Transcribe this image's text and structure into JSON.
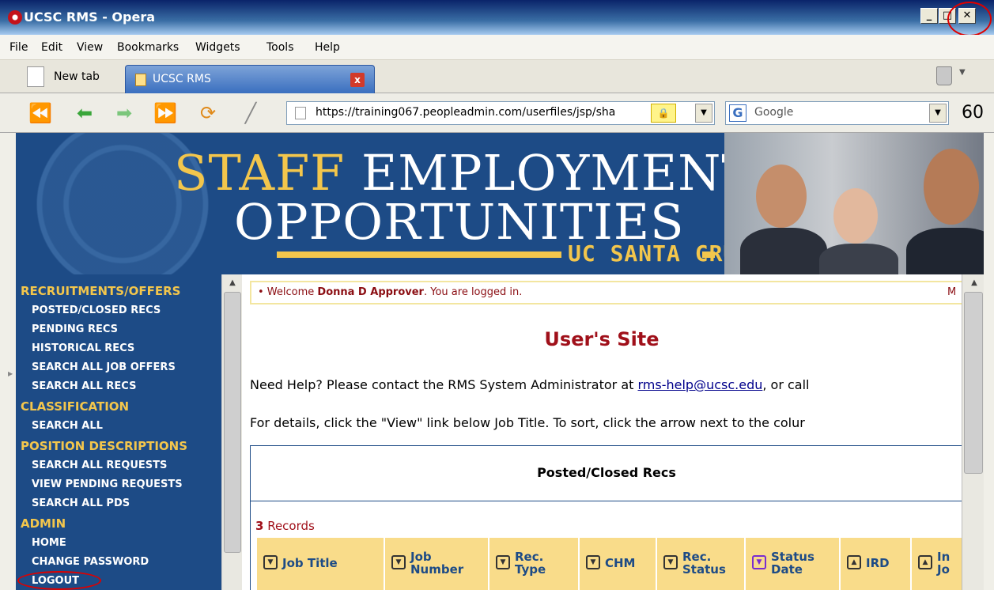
{
  "window": {
    "title": "UCSC RMS - Opera",
    "minimize": "_",
    "maximize": "□",
    "close": "✕"
  },
  "menu": [
    "File",
    "Edit",
    "View",
    "Bookmarks",
    "Widgets",
    "Tools",
    "Help"
  ],
  "tabs": {
    "new_tab": "New tab",
    "active": "UCSC RMS",
    "close": "x"
  },
  "nav": {
    "url": "https://training067.peopleadmin.com/userfiles/jsp/sha",
    "search_placeholder": "Google",
    "icons": [
      "rewind-icon",
      "back-icon",
      "forward-icon",
      "fast-forward-icon",
      "reload-icon",
      "edit-icon"
    ]
  },
  "banner": {
    "line1_gold": "STAFF",
    "line1_white": "EMPLOYMENT",
    "line2": "OPPORTUNITIES",
    "campus": "UC SANTA CRUZ"
  },
  "sidebar": {
    "recruitments": "RECRUITMENTS/OFFERS",
    "posted_closed": "POSTED/CLOSED RECS",
    "pending": "PENDING RECS",
    "historical": "HISTORICAL RECS",
    "search_offers": "SEARCH ALL JOB OFFERS",
    "search_recs": "SEARCH ALL RECS",
    "classification": "CLASSIFICATION",
    "search_all": "SEARCH ALL",
    "position_desc": "POSITION DESCRIPTIONS",
    "search_requests": "SEARCH ALL REQUESTS",
    "view_pending": "VIEW PENDING REQUESTS",
    "search_pds": "SEARCH ALL PDS",
    "admin": "ADMIN",
    "home": "HOME",
    "change_password": "CHANGE PASSWORD",
    "logout": "LOGOUT"
  },
  "main": {
    "welcome_pre": "• Welcome ",
    "welcome_name": "Donna D Approver",
    "welcome_post": ". You are logged in.",
    "welcome_trunc": "M",
    "site_title": "User's Site",
    "help_pre": "Need Help? Please contact the RMS System Administrator at ",
    "help_email": "rms-help@ucsc.edu",
    "help_post": ", or call",
    "details": "For details, click the \"View\" link below Job Title. To sort, click the arrow next to the colur",
    "panel_title": "Posted/Closed Recs",
    "records_count": "3",
    "records_label": " Records",
    "columns": {
      "job_title": "Job Title",
      "job_number_1": "Job",
      "job_number_2": "Number",
      "rec_type_1": "Rec.",
      "rec_type_2": "Type",
      "chm": "CHM",
      "rec_status_1": "Rec.",
      "rec_status_2": "Status",
      "status_date_1": "Status",
      "status_date_2": "Date",
      "ird": "IRD",
      "in_1": "In",
      "in_2": "Jo"
    },
    "sort_glyphs": {
      "down": "▼",
      "up": "▲"
    }
  },
  "colors": {
    "accent": "#1d4b86",
    "gold": "#f3c64c",
    "title_red": "#a0101a",
    "header_fill": "#f9dc8a"
  }
}
